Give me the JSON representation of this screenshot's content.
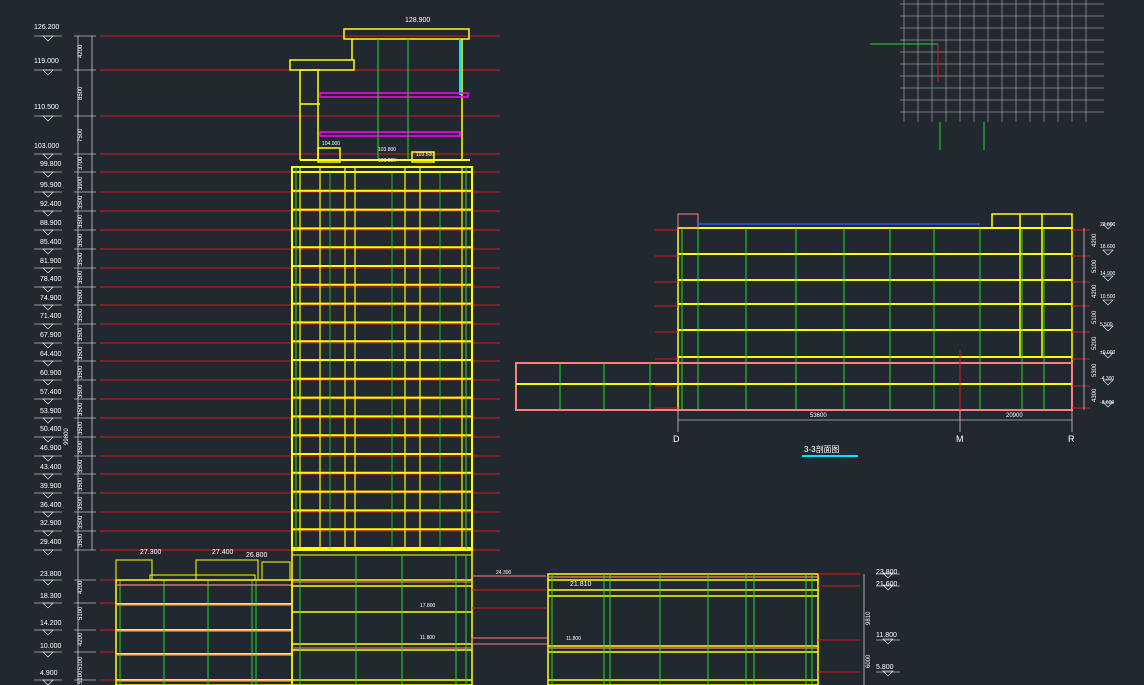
{
  "colors": {
    "background": "#212830",
    "level_line": "#e01818",
    "slab": "#ffff00",
    "wall": "#ffff00",
    "column": "#22dd22",
    "podium_slab": "#ff7f7f",
    "text": "#ffffff",
    "cyan": "#00e5ff",
    "magenta": "#ff00ff",
    "blue": "#2850ff"
  },
  "main_section": {
    "top_level_label": "128.900",
    "left_elevations": [
      "126.200",
      "119.000",
      "110.500",
      "103.000",
      "99.800",
      "95.900",
      "92.400",
      "88.900",
      "85.400",
      "81.900",
      "78.400",
      "74.900",
      "71.400",
      "67.900",
      "64.400",
      "60.900",
      "57.400",
      "53.900",
      "50.400",
      "46.900",
      "43.400",
      "39.900",
      "36.400",
      "32.900",
      "29.400"
    ],
    "left_dims": [
      "4200",
      "8500",
      "7500",
      "3700",
      "3900",
      "3500",
      "3500",
      "3500",
      "3500",
      "3500",
      "3500",
      "3500",
      "3500",
      "3500",
      "3500",
      "3500",
      "3500",
      "3500",
      "3500",
      "3500",
      "3500",
      "3500",
      "3500",
      "3500"
    ],
    "middle_dim": "99800",
    "podium_elevations": [
      "23.800",
      "18.300",
      "14.200",
      "10.000",
      "4.900"
    ],
    "podium_dims": [
      "4200",
      "5100",
      "4200",
      "5100",
      "5100"
    ],
    "podium_roof_labels": [
      "27.300",
      "27.400",
      "26.800"
    ],
    "tower_small_labels": [
      "104.000",
      "103.800",
      "103.500",
      "100.000"
    ],
    "podium_inner_labels": [
      "17.800",
      "11.800"
    ]
  },
  "right_podium": {
    "top_label": "21.810",
    "inner_labels": [
      "24.300",
      "11.800"
    ],
    "right_elevations": [
      "23.800",
      "21.600",
      "11.800",
      "5.800"
    ],
    "right_dims": [
      "9810",
      "6000"
    ]
  },
  "section_33": {
    "title": "3-3剖面图",
    "axis_labels": [
      "D",
      "M",
      "R"
    ],
    "span_dims": [
      "53600",
      "20900"
    ],
    "right_elevations": [
      "22.800",
      "18.600",
      "14.900",
      "10.500",
      "5.500",
      "±0.000",
      "-4.300",
      "-8.600"
    ],
    "right_dims": [
      "4200",
      "5100",
      "4200",
      "5100",
      "5200",
      "5300",
      "4300"
    ]
  }
}
